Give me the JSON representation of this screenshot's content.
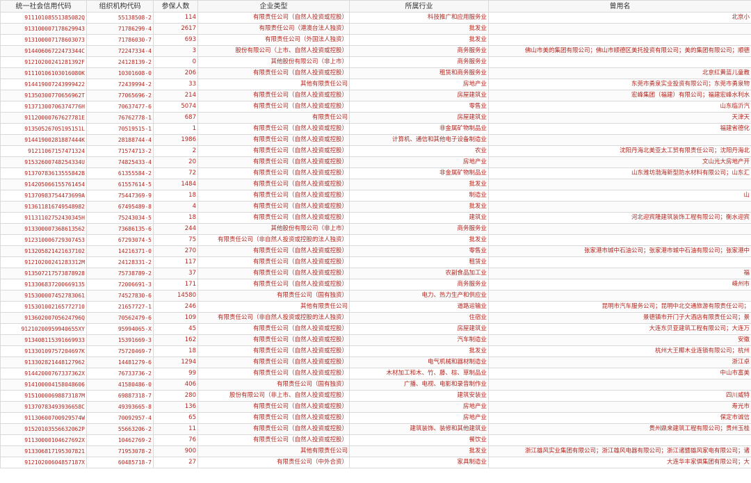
{
  "table": {
    "headers": [
      "统一社会信用代码",
      "组织机构代码",
      "参保人数",
      "企业类型",
      "所属行业",
      "曾用名"
    ],
    "rows": [
      [
        "91110108551385082Q",
        "55138508-2",
        "114",
        "有限责任公司（自然人投资或控股）",
        "科技推广和应用服务业",
        "北京小"
      ],
      [
        "913100007178629943",
        "71786299-4",
        "2617",
        "有限责任公司（港澳台法人独资）",
        "批发业",
        ""
      ],
      [
        "913100007178603073",
        "71786030-7",
        "693",
        "有限责任公司（外国法人独资）",
        "批发业",
        ""
      ],
      [
        "91440606722473344C",
        "72247334-4",
        "3",
        "股份有限公司（上市、自然人投资或控股）",
        "商务服务业",
        "佛山市美的集团有限公司；佛山市顺德区美托投资有限公司；美的集团有限公司；顺德"
      ],
      [
        "91210200241281392F",
        "24128139-2",
        "0",
        "其他股份有限公司（非上市）",
        "商务服务业",
        ""
      ],
      [
        "91110106103016080K",
        "10301608-0",
        "206",
        "有限责任公司（自然人投资或控股）",
        "租赁和商务服务业",
        "北京红黄蓝儿童教"
      ],
      [
        "914419007243999422",
        "72439994-2",
        "33",
        "其他有限责任公司",
        "房地产业",
        "东莞市勇泉实业投资有限公司；东莞市勇泉物"
      ],
      [
        "91350300770656962T",
        "77065696-2",
        "214",
        "有限责任公司（自然人投资或控股）",
        "房屋建筑业",
        "宏峰集团（福建）有限公司；福建宏峰水利水"
      ],
      [
        "91371300706374776H",
        "70637477-6",
        "5074",
        "有限责任公司（自然人投资或控股）",
        "零售业",
        "山东临沂汽"
      ],
      [
        "91120000767627781E",
        "76762778-1",
        "687",
        "有限责任公司",
        "房屋建筑业",
        "天津天"
      ],
      [
        "91350526705195151L",
        "70519515-1",
        "1",
        "有限责任公司（自然人投资或控股）",
        "非金属矿物制品业",
        "福建省德化"
      ],
      [
        "91441900281887444K",
        "28188744-4",
        "1986",
        "有限责任公司（自然人投资或控股）",
        "计算机、通信和其他电子设备制造业",
        ""
      ],
      [
        "91211067157471324",
        "71574713-2",
        "2",
        "有限责任公司（自然人投资或控股）",
        "农业",
        "沈阳丹海北美亚太工贸有限责任公司；沈阳丹海北"
      ],
      [
        "91532600748254334U",
        "74825433-4",
        "20",
        "有限责任公司（自然人投资或控股）",
        "房地产业",
        "文山光大房地产开"
      ],
      [
        "91370783613555842B",
        "61355584-2",
        "72",
        "有限责任公司（自然人投资或控股）",
        "非金属矿物制品业",
        "山东潍坊渤海新型防水材料有限公司；山东汇"
      ],
      [
        "914205066155761454",
        "61557614-5",
        "1484",
        "有限责任公司（自然人投资或控股）",
        "批发业",
        ""
      ],
      [
        "91370983754473699A",
        "75447369-9",
        "18",
        "有限责任公司（自然人投资或控股）",
        "制造业",
        "山"
      ],
      [
        "913611816749548982",
        "67495489-8",
        "4",
        "有限责任公司（自然人投资或控股）",
        "批发业",
        ""
      ],
      [
        "91131102752430345H",
        "75243034-5",
        "18",
        "有限责任公司（自然人投资或控股）",
        "建筑业",
        "河北迎宾隆建筑装饰工程有限公司；衡水迎宾"
      ],
      [
        "913300007368613562",
        "73686135-6",
        "244",
        "其他股份有限公司（非上市）",
        "商务服务业",
        ""
      ],
      [
        "912310006729307453",
        "67293074-5",
        "75",
        "有限责任公司（非自然人投资或控股的法人独资）",
        "批发业",
        ""
      ],
      [
        "913205821421637102",
        "14216371-0",
        "270",
        "有限责任公司（自然人投资或控股）",
        "零售业",
        "张家港市城中石油公司；张家港市城中石油有限公司；张家港中"
      ],
      [
        "91210200241283312M",
        "24128331-2",
        "117",
        "有限责任公司（自然人投资或控股）",
        "租赁业",
        ""
      ],
      [
        "913507217573878928",
        "75738789-2",
        "37",
        "有限责任公司（自然人投资或控股）",
        "农副食品加工业",
        "福"
      ],
      [
        "913306837200669135",
        "72006691-3",
        "171",
        "有限责任公司（自然人投资或控股）",
        "商务服务业",
        "嵊州市"
      ],
      [
        "915300007452783061",
        "74527830-6",
        "14580",
        "有限责任公司（国有独资）",
        "电力、热力生产和供应业",
        ""
      ],
      [
        "915301002165772710",
        "21657727-1",
        "246",
        "其他有限责任公司",
        "道路运输业",
        "昆明市汽车服务公司；昆明中北交通旅游有限责任公司；"
      ],
      [
        "91360200705624796Q",
        "70562479-6",
        "109",
        "有限责任公司（非自然人投资或控股的法人独资）",
        "住宿业",
        "景德镇市开门子大酒店有限责任公司；景"
      ],
      [
        "91210200959940655XY",
        "95994065-X",
        "45",
        "有限责任公司（自然人投资或控股）",
        "房屋建筑业",
        "大连东贝亚建筑工程有限公司；大连万"
      ],
      [
        "913408115391669933",
        "15391669-3",
        "162",
        "有限责任公司（自然人投资或控股）",
        "汽车制造业",
        "安徽"
      ],
      [
        "91330109757204697K",
        "75720469-7",
        "18",
        "有限责任公司（自然人投资或控股）",
        "批发业",
        "杭州大王椰木业连锁有限公司；杭州"
      ],
      [
        "913302821448127962",
        "14481279-6",
        "1294",
        "有限责任公司（自然人投资或控股）",
        "电气机械和器材制造业",
        "浙江卓"
      ],
      [
        "91442000767337362X",
        "76733736-2",
        "99",
        "有限责任公司（自然人投资或控股）",
        "木材加工和木、竹、藤、棕、草制品业",
        "中山市富美"
      ],
      [
        "914100004158048606",
        "41580486-0",
        "406",
        "有限责任公司（国有独资）",
        "广播、电视、电影和录音制作业",
        ""
      ],
      [
        "91510000698873187M",
        "69887318-7",
        "280",
        "股份有限公司（非上市、自然人投资或控股）",
        "建筑安装业",
        "四川威特"
      ],
      [
        "91370783493936658C",
        "49393665-8",
        "136",
        "有限责任公司（自然人投资或控股）",
        "房地产业",
        "寿光市"
      ],
      [
        "91130600700929574W",
        "70092957-4",
        "65",
        "有限责任公司（自然人投资或控股）",
        "房地产业",
        "保定市诚信"
      ],
      [
        "91520103556632062P",
        "55663206-2",
        "11",
        "有限责任公司（自然人投资或控股）",
        "建筑装饰、装修和其他建筑业",
        "贵州鼎来建筑工程有限公司；贵州玉桂"
      ],
      [
        "91130000104627692X",
        "10462769-2",
        "76",
        "有限责任公司（自然人投资或控股）",
        "餐饮业",
        ""
      ],
      [
        "913306817195307821",
        "71953078-2",
        "900",
        "其他有限责任公司",
        "批发业",
        "浙江雄风实业集团有限公司；浙江雄风电器有限公司；浙江诸暨雄风家电有限公司；诸"
      ],
      [
        "91210200604857187X",
        "60485718-7",
        "27",
        "有限责任公司（中外合资）",
        "家具制造业",
        "大连华丰家俱集团有限公司；大"
      ]
    ]
  }
}
